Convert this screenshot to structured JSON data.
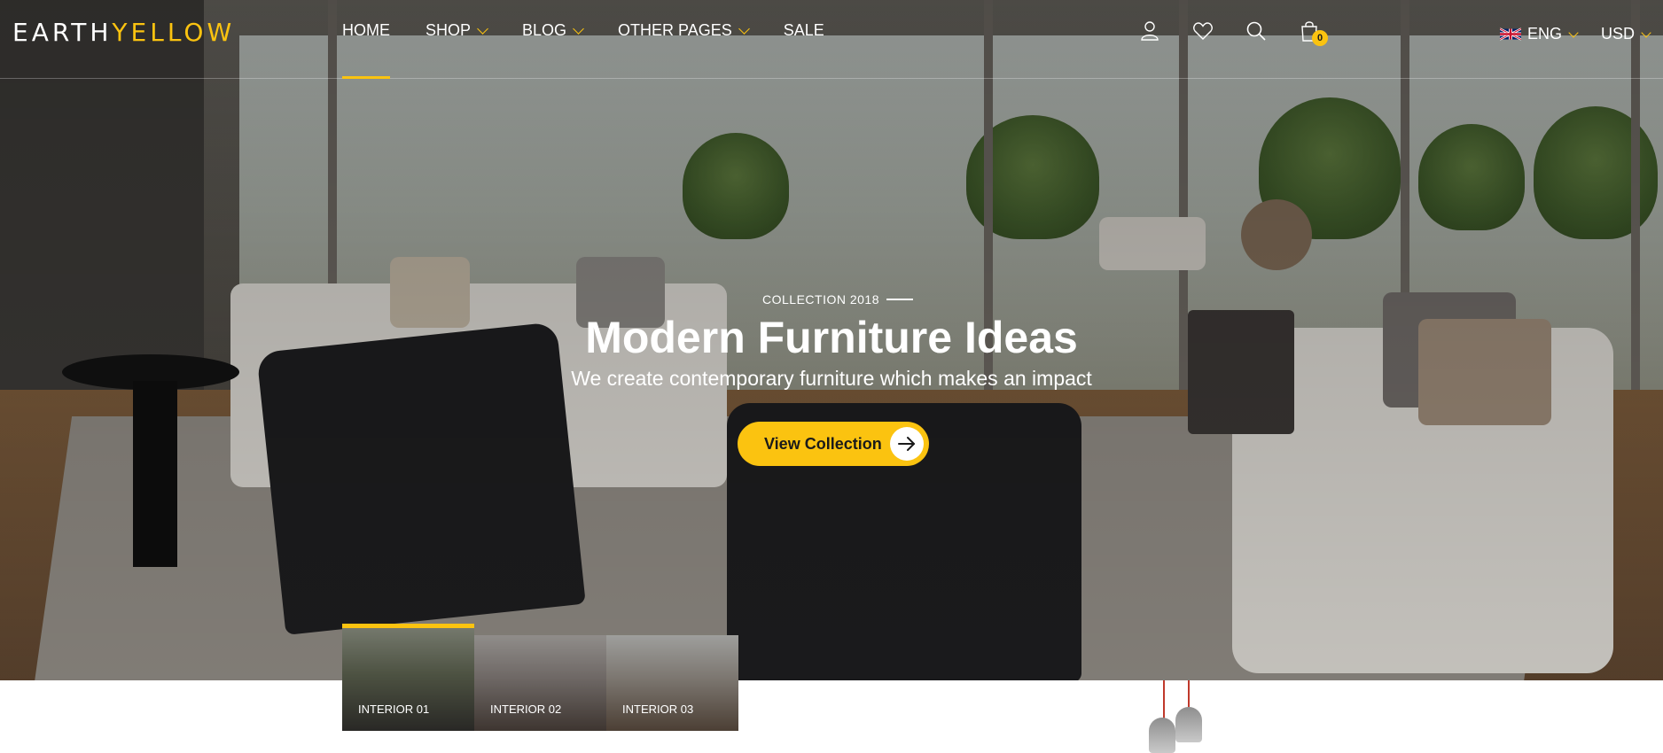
{
  "brand": {
    "part1": "EARTH",
    "part2": "YELLOW",
    "accent_color": "#fbc310"
  },
  "nav": {
    "items": [
      {
        "label": "HOME",
        "active": true,
        "dropdown": false
      },
      {
        "label": "SHOP",
        "active": false,
        "dropdown": true
      },
      {
        "label": "BLOG",
        "active": false,
        "dropdown": true
      },
      {
        "label": "OTHER PAGES",
        "active": false,
        "dropdown": true
      },
      {
        "label": "SALE",
        "active": false,
        "dropdown": false
      }
    ]
  },
  "header_icons": {
    "account": "user-icon",
    "wishlist": "heart-icon",
    "search": "search-icon",
    "cart": "shopping-bag-icon",
    "cart_count": "0"
  },
  "locale": {
    "language": "ENG",
    "language_flag": "uk-flag-icon",
    "currency": "USD"
  },
  "hero": {
    "eyebrow": "COLLECTION 2018",
    "title": "Modern Furniture Ideas",
    "subtitle": "We create contemporary furniture which makes an impact",
    "cta_label": "View Collection",
    "cta_icon": "arrow-right-icon"
  },
  "thumbnails": [
    {
      "label": "INTERIOR 01",
      "active": true
    },
    {
      "label": "INTERIOR 02",
      "active": false
    },
    {
      "label": "INTERIOR 03",
      "active": false
    }
  ]
}
